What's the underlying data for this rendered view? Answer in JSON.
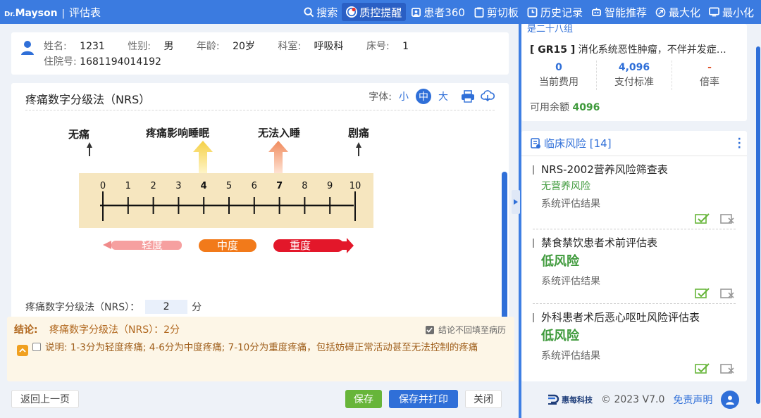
{
  "topbar": {
    "brand_dr": "Dr.",
    "brand_name": "Mayson",
    "brand_sep": "|",
    "app_title": "评估表",
    "menu": [
      {
        "label": "搜索",
        "icon": "search-icon"
      },
      {
        "label": "质控提醒",
        "icon": "alert-icon",
        "active": true
      },
      {
        "label": "患者360",
        "icon": "patient-icon"
      },
      {
        "label": "剪切板",
        "icon": "clipboard-icon"
      },
      {
        "label": "历史记录",
        "icon": "history-icon"
      },
      {
        "label": "智能推荐",
        "icon": "robot-icon"
      },
      {
        "label": "最大化",
        "icon": "maximize-icon"
      },
      {
        "label": "最小化",
        "icon": "minimize-icon"
      }
    ]
  },
  "patient": {
    "name_k": "姓名:",
    "name_v": "1231",
    "sex_k": "性别:",
    "sex_v": "男",
    "age_k": "年龄:",
    "age_v": "20岁",
    "dept_k": "科室:",
    "dept_v": "呼吸科",
    "bed_k": "床号:",
    "bed_v": "1",
    "admission_k": "住院号:",
    "admission_v": "1681194014192"
  },
  "form": {
    "title": "疼痛数字分级法（NRS）",
    "font_label": "字体:",
    "font_small": "小",
    "font_medium": "中",
    "font_large": "大",
    "scale": {
      "top_labels": [
        "无痛",
        "疼痛影响睡眠",
        "无法入睡",
        "剧痛"
      ],
      "numbers": [
        "0",
        "1",
        "2",
        "3",
        "4",
        "5",
        "6",
        "7",
        "8",
        "9",
        "10"
      ],
      "bold_numbers": [
        "4",
        "7"
      ],
      "bands": [
        "轻度",
        "中度",
        "重度"
      ]
    },
    "score_label": "疼痛数字分级法（NRS）：",
    "score_value": "2",
    "score_unit": "分"
  },
  "conclusion": {
    "label": "结论:",
    "text": "疼痛数字分级法（NRS）：2分",
    "option": "结论不回填至病历",
    "desc": "说明:  1-3分为轻度疼痛; 4-6分为中度疼痛; 7-10分为重度疼痛，包括妨碍正常活动甚至无法控制的疼痛"
  },
  "buttons": {
    "back": "返回上一页",
    "save": "保存",
    "save_print": "保存并打印",
    "close": "关闭"
  },
  "drg": {
    "cut_label": "是二十八组",
    "code": "[ GR15 ]",
    "desc": "消化系统恶性肿瘤，不伴并发症…",
    "stats": [
      {
        "value": "0",
        "label": "当前费用"
      },
      {
        "value": "4,096",
        "label": "支付标准"
      },
      {
        "value": "-",
        "label": "倍率"
      }
    ],
    "balance_label": "可用余额",
    "balance_value": "4096"
  },
  "risk": {
    "title": "临床风险 [14]",
    "items": [
      {
        "name": "NRS-2002营养风险筛查表",
        "level": "无营养风险",
        "result": "系统评估结果"
      },
      {
        "name": "禁食禁饮患者术前评估表",
        "level": "低风险",
        "result": "系统评估结果"
      },
      {
        "name": "外科患者术后恶心呕吐风险评估表",
        "level": "低风险",
        "result": "系统评估结果"
      }
    ]
  },
  "footer": {
    "logo_text": "惠每科技",
    "version": "© 2023 V7.0",
    "disclaimer": "免责声明"
  },
  "colors": {
    "primary": "#2f6fd8",
    "topbar": "#3b7be0",
    "green": "#3f9a3c",
    "orange": "#b1681f"
  }
}
